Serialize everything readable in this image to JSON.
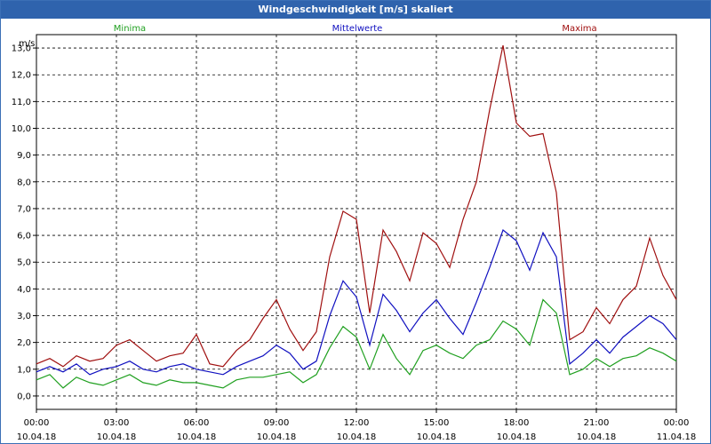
{
  "window": {
    "title": "Windgeschwindigkeit [m/s] skaliert"
  },
  "chart_data": {
    "type": "line",
    "title": "Windgeschwindigkeit [m/s] skaliert",
    "ylabel": "m/s",
    "ylim": [
      -0.5,
      13.5
    ],
    "yticks": [
      "0,0",
      "1,0",
      "2,0",
      "3,0",
      "4,0",
      "5,0",
      "6,0",
      "7,0",
      "8,0",
      "9,0",
      "10,0",
      "11,0",
      "12,0",
      "13,0"
    ],
    "xticks": [
      {
        "time": "00:00",
        "date": "10.04.18"
      },
      {
        "time": "03:00",
        "date": "10.04.18"
      },
      {
        "time": "06:00",
        "date": "10.04.18"
      },
      {
        "time": "09:00",
        "date": "10.04.18"
      },
      {
        "time": "12:00",
        "date": "10.04.18"
      },
      {
        "time": "15:00",
        "date": "10.04.18"
      },
      {
        "time": "18:00",
        "date": "10.04.18"
      },
      {
        "time": "21:00",
        "date": "10.04.18"
      },
      {
        "time": "00:00",
        "date": "11.04.18"
      }
    ],
    "grid": true,
    "x_hours": [
      0,
      0.5,
      1,
      1.5,
      2,
      2.5,
      3,
      3.5,
      4,
      4.5,
      5,
      5.5,
      6,
      6.5,
      7,
      7.5,
      8,
      8.5,
      9,
      9.5,
      10,
      10.5,
      11,
      11.5,
      12,
      12.5,
      13,
      13.5,
      14,
      14.5,
      15,
      15.5,
      16,
      16.5,
      17,
      17.5,
      18,
      18.5,
      19,
      19.5,
      20,
      20.5,
      21,
      21.5,
      22,
      22.5,
      23,
      23.5,
      24
    ],
    "series": [
      {
        "name": "Minima",
        "color": "#20a020",
        "values": [
          0.6,
          0.8,
          0.3,
          0.7,
          0.5,
          0.4,
          0.6,
          0.8,
          0.5,
          0.4,
          0.6,
          0.5,
          0.5,
          0.4,
          0.3,
          0.6,
          0.7,
          0.7,
          0.8,
          0.9,
          0.5,
          0.8,
          1.8,
          2.6,
          2.2,
          1.0,
          2.3,
          1.4,
          0.8,
          1.7,
          1.9,
          1.6,
          1.4,
          1.9,
          2.1,
          2.8,
          2.5,
          1.9,
          3.6,
          3.1,
          0.8,
          1.0,
          1.4,
          1.1,
          1.4,
          1.5,
          1.8,
          1.6,
          1.3
        ]
      },
      {
        "name": "Mittelwerte",
        "color": "#1010c0",
        "values": [
          0.9,
          1.1,
          0.9,
          1.2,
          0.8,
          1.0,
          1.1,
          1.3,
          1.0,
          0.9,
          1.1,
          1.2,
          1.0,
          0.9,
          0.8,
          1.1,
          1.3,
          1.5,
          1.9,
          1.6,
          1.0,
          1.3,
          3.0,
          4.3,
          3.7,
          1.9,
          3.8,
          3.2,
          2.4,
          3.1,
          3.6,
          2.9,
          2.3,
          3.5,
          4.8,
          6.2,
          5.8,
          4.7,
          6.1,
          5.2,
          1.2,
          1.6,
          2.1,
          1.6,
          2.2,
          2.6,
          3.0,
          2.7,
          2.1
        ]
      },
      {
        "name": "Maxima",
        "color": "#a01010",
        "values": [
          1.2,
          1.4,
          1.1,
          1.5,
          1.3,
          1.4,
          1.9,
          2.1,
          1.7,
          1.3,
          1.5,
          1.6,
          2.3,
          1.2,
          1.1,
          1.7,
          2.1,
          2.9,
          3.6,
          2.5,
          1.7,
          2.4,
          5.2,
          6.9,
          6.6,
          3.1,
          6.2,
          5.4,
          4.3,
          6.1,
          5.7,
          4.8,
          6.6,
          8.0,
          10.7,
          13.1,
          10.2,
          9.7,
          9.8,
          7.6,
          2.1,
          2.4,
          3.3,
          2.7,
          3.6,
          4.1,
          5.9,
          4.5,
          3.6
        ]
      }
    ]
  }
}
